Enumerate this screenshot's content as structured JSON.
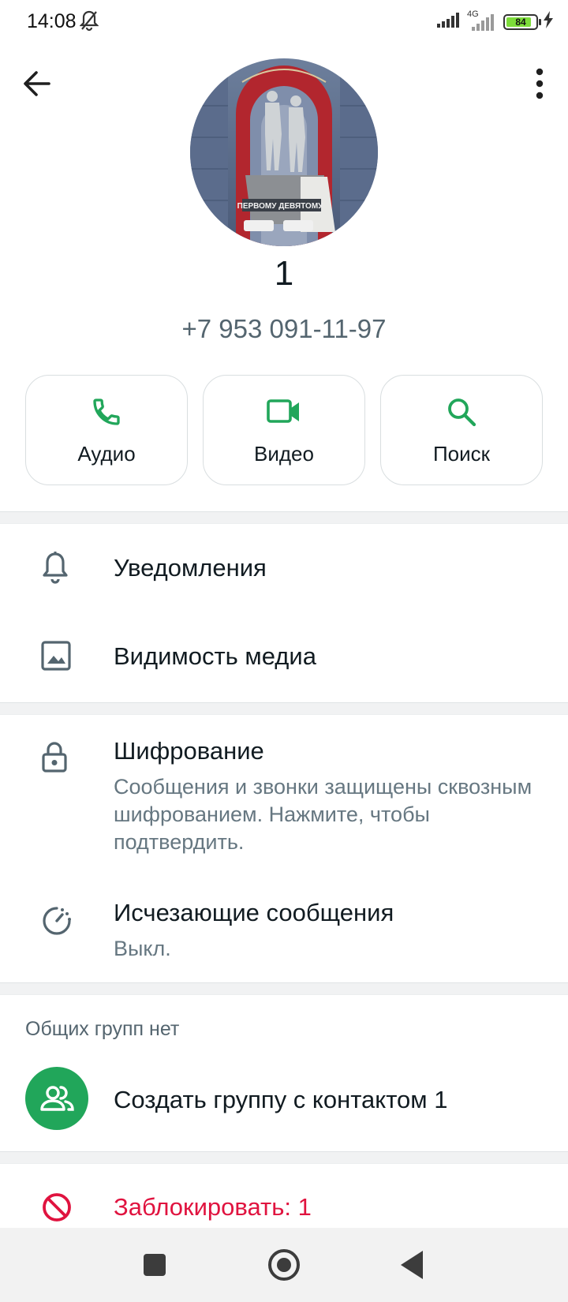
{
  "status_bar": {
    "time": "14:08",
    "network": "4G",
    "battery": "84",
    "battery_level": 0.84
  },
  "contact": {
    "avatar_caption": "ПЕРВОМУ ДЕВЯТОМУ",
    "name": "1",
    "phone": "+7 953 091-11-97"
  },
  "actions": [
    {
      "label": "Аудио",
      "icon": "phone-icon"
    },
    {
      "label": "Видео",
      "icon": "video-icon"
    },
    {
      "label": "Поиск",
      "icon": "search-icon"
    }
  ],
  "settings": {
    "notifications": "Уведомления",
    "media_visibility": "Видимость медиа",
    "encryption_title": "Шифрование",
    "encryption_sub": "Сообщения и звонки защищены сквозным шифрованием. Нажмите, чтобы подтвердить.",
    "disappearing_title": "Исчезающие сообщения",
    "disappearing_sub": "Выкл."
  },
  "groups": {
    "header": "Общих групп нет",
    "create": "Создать группу с контактом 1"
  },
  "block": {
    "label": "Заблокировать: 1"
  },
  "colors": {
    "accent": "#21a65a",
    "danger": "#e0133f"
  }
}
